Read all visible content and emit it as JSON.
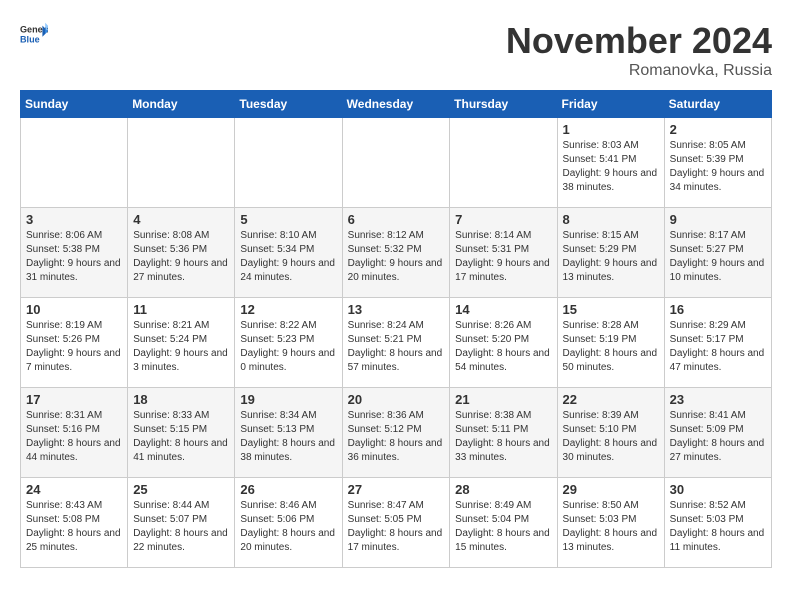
{
  "header": {
    "logo_general": "General",
    "logo_blue": "Blue",
    "title": "November 2024",
    "location": "Romanovka, Russia"
  },
  "days_of_week": [
    "Sunday",
    "Monday",
    "Tuesday",
    "Wednesday",
    "Thursday",
    "Friday",
    "Saturday"
  ],
  "weeks": [
    [
      {
        "day": "",
        "info": ""
      },
      {
        "day": "",
        "info": ""
      },
      {
        "day": "",
        "info": ""
      },
      {
        "day": "",
        "info": ""
      },
      {
        "day": "",
        "info": ""
      },
      {
        "day": "1",
        "info": "Sunrise: 8:03 AM\nSunset: 5:41 PM\nDaylight: 9 hours\nand 38 minutes."
      },
      {
        "day": "2",
        "info": "Sunrise: 8:05 AM\nSunset: 5:39 PM\nDaylight: 9 hours\nand 34 minutes."
      }
    ],
    [
      {
        "day": "3",
        "info": "Sunrise: 8:06 AM\nSunset: 5:38 PM\nDaylight: 9 hours\nand 31 minutes."
      },
      {
        "day": "4",
        "info": "Sunrise: 8:08 AM\nSunset: 5:36 PM\nDaylight: 9 hours\nand 27 minutes."
      },
      {
        "day": "5",
        "info": "Sunrise: 8:10 AM\nSunset: 5:34 PM\nDaylight: 9 hours\nand 24 minutes."
      },
      {
        "day": "6",
        "info": "Sunrise: 8:12 AM\nSunset: 5:32 PM\nDaylight: 9 hours\nand 20 minutes."
      },
      {
        "day": "7",
        "info": "Sunrise: 8:14 AM\nSunset: 5:31 PM\nDaylight: 9 hours\nand 17 minutes."
      },
      {
        "day": "8",
        "info": "Sunrise: 8:15 AM\nSunset: 5:29 PM\nDaylight: 9 hours\nand 13 minutes."
      },
      {
        "day": "9",
        "info": "Sunrise: 8:17 AM\nSunset: 5:27 PM\nDaylight: 9 hours\nand 10 minutes."
      }
    ],
    [
      {
        "day": "10",
        "info": "Sunrise: 8:19 AM\nSunset: 5:26 PM\nDaylight: 9 hours\nand 7 minutes."
      },
      {
        "day": "11",
        "info": "Sunrise: 8:21 AM\nSunset: 5:24 PM\nDaylight: 9 hours\nand 3 minutes."
      },
      {
        "day": "12",
        "info": "Sunrise: 8:22 AM\nSunset: 5:23 PM\nDaylight: 9 hours\nand 0 minutes."
      },
      {
        "day": "13",
        "info": "Sunrise: 8:24 AM\nSunset: 5:21 PM\nDaylight: 8 hours\nand 57 minutes."
      },
      {
        "day": "14",
        "info": "Sunrise: 8:26 AM\nSunset: 5:20 PM\nDaylight: 8 hours\nand 54 minutes."
      },
      {
        "day": "15",
        "info": "Sunrise: 8:28 AM\nSunset: 5:19 PM\nDaylight: 8 hours\nand 50 minutes."
      },
      {
        "day": "16",
        "info": "Sunrise: 8:29 AM\nSunset: 5:17 PM\nDaylight: 8 hours\nand 47 minutes."
      }
    ],
    [
      {
        "day": "17",
        "info": "Sunrise: 8:31 AM\nSunset: 5:16 PM\nDaylight: 8 hours\nand 44 minutes."
      },
      {
        "day": "18",
        "info": "Sunrise: 8:33 AM\nSunset: 5:15 PM\nDaylight: 8 hours\nand 41 minutes."
      },
      {
        "day": "19",
        "info": "Sunrise: 8:34 AM\nSunset: 5:13 PM\nDaylight: 8 hours\nand 38 minutes."
      },
      {
        "day": "20",
        "info": "Sunrise: 8:36 AM\nSunset: 5:12 PM\nDaylight: 8 hours\nand 36 minutes."
      },
      {
        "day": "21",
        "info": "Sunrise: 8:38 AM\nSunset: 5:11 PM\nDaylight: 8 hours\nand 33 minutes."
      },
      {
        "day": "22",
        "info": "Sunrise: 8:39 AM\nSunset: 5:10 PM\nDaylight: 8 hours\nand 30 minutes."
      },
      {
        "day": "23",
        "info": "Sunrise: 8:41 AM\nSunset: 5:09 PM\nDaylight: 8 hours\nand 27 minutes."
      }
    ],
    [
      {
        "day": "24",
        "info": "Sunrise: 8:43 AM\nSunset: 5:08 PM\nDaylight: 8 hours\nand 25 minutes."
      },
      {
        "day": "25",
        "info": "Sunrise: 8:44 AM\nSunset: 5:07 PM\nDaylight: 8 hours\nand 22 minutes."
      },
      {
        "day": "26",
        "info": "Sunrise: 8:46 AM\nSunset: 5:06 PM\nDaylight: 8 hours\nand 20 minutes."
      },
      {
        "day": "27",
        "info": "Sunrise: 8:47 AM\nSunset: 5:05 PM\nDaylight: 8 hours\nand 17 minutes."
      },
      {
        "day": "28",
        "info": "Sunrise: 8:49 AM\nSunset: 5:04 PM\nDaylight: 8 hours\nand 15 minutes."
      },
      {
        "day": "29",
        "info": "Sunrise: 8:50 AM\nSunset: 5:03 PM\nDaylight: 8 hours\nand 13 minutes."
      },
      {
        "day": "30",
        "info": "Sunrise: 8:52 AM\nSunset: 5:03 PM\nDaylight: 8 hours\nand 11 minutes."
      }
    ]
  ]
}
